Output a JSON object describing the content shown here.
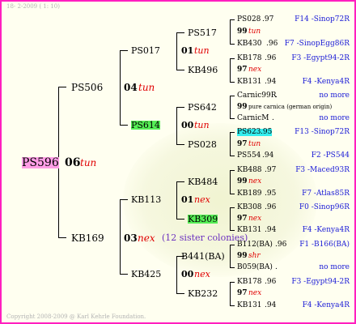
{
  "header": "18-  2-2009 ( 1: 10)",
  "footer": "Copyright 2008-2009 @ Karl Kehrle Foundation.",
  "root": {
    "name": "PS596",
    "year": "06",
    "tag": "tun"
  },
  "gen1": [
    {
      "name": "PS506",
      "year": "04",
      "tag": "tun"
    },
    {
      "name": "KB169",
      "year": "03",
      "tag": "nex",
      "note": "(12 sister colonies)"
    }
  ],
  "gen2": [
    {
      "name": "PS017",
      "year": "01",
      "tag": "tun"
    },
    {
      "name": "PS614",
      "year": "00",
      "tag": "tun"
    },
    {
      "name": "KB113",
      "year": "01",
      "tag": "nex"
    },
    {
      "name": "KB425",
      "year": "00",
      "tag": "nex"
    }
  ],
  "gen3": [
    {
      "name": "PS517",
      "year": "99",
      "tag": "tun"
    },
    {
      "name": "KB496",
      "year": "97",
      "tag": "nex"
    },
    {
      "name": "PS642",
      "year": "99",
      "tag": "pure carnica (german origin)"
    },
    {
      "name": "PS028",
      "year": "97",
      "tag": "tun"
    },
    {
      "name": "KB484",
      "year": "99",
      "tag": "nex"
    },
    {
      "name": "KB309",
      "year": "97",
      "tag": "nex"
    },
    {
      "name": "B441(BA)",
      "year": "99",
      "tag": "shr"
    },
    {
      "name": "KB232",
      "year": "97",
      "tag": "nex"
    }
  ],
  "gen4": [
    {
      "name": "PS028",
      "pct": ".97",
      "link": "F14 -Sinop72R"
    },
    {
      "name": "KB430",
      "pct": ".96",
      "link": "F7 -SinopEgg86R"
    },
    {
      "name": "KB178",
      "pct": ".96",
      "link": "F3 -Egypt94-2R"
    },
    {
      "name": "KB131",
      "pct": ".94",
      "link": "F4 -Kenya4R"
    },
    {
      "name": "Carnic99R",
      "pct": ".",
      "link": "no more"
    },
    {
      "name": "CarnicM",
      "pct": ".",
      "link": "no more"
    },
    {
      "name": "PS623",
      "pct": ".95",
      "link": "F13 -Sinop72R"
    },
    {
      "name": "PS554",
      "pct": ".94",
      "link": "F2 -PS544"
    },
    {
      "name": "KB488",
      "pct": ".97",
      "link": "F3 -Maced93R"
    },
    {
      "name": "KB189",
      "pct": ".95",
      "link": "F7 -Atlas85R"
    },
    {
      "name": "KB308",
      "pct": ".96",
      "link": "F0 -Sinop96R"
    },
    {
      "name": "KB131",
      "pct": ".94",
      "link": "F4 -Kenya4R"
    },
    {
      "name": "B112(BA)",
      "pct": ".96",
      "link": "F1 -B166(BA)"
    },
    {
      "name": "B059(BA)",
      "pct": ".",
      "link": "no more"
    },
    {
      "name": "KB178",
      "pct": ".96",
      "link": "F3 -Egypt94-2R"
    },
    {
      "name": "KB131",
      "pct": ".94",
      "link": "F4 -Kenya4R"
    }
  ]
}
